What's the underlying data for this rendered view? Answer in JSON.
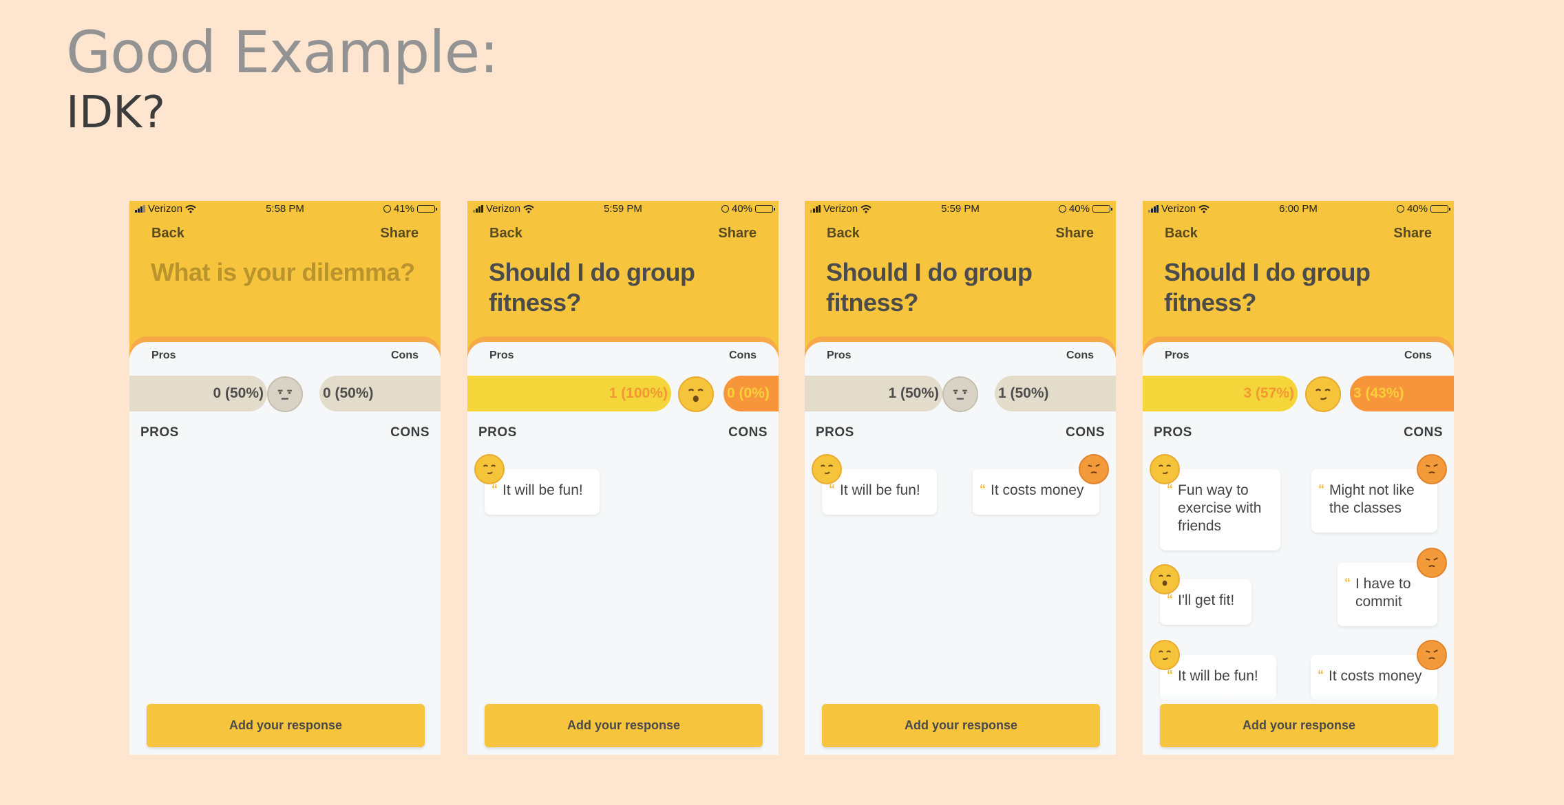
{
  "slide": {
    "title": "Good Example:",
    "subtitle": "IDK?"
  },
  "colors": {
    "accent_yellow": "#f6c53d",
    "accent_orange": "#f7953a",
    "background": "#fde5cf"
  },
  "phones": [
    {
      "status": {
        "carrier": "Verizon",
        "time": "5:58 PM",
        "battery": "41%"
      },
      "nav": {
        "back": "Back",
        "share": "Share"
      },
      "question": "What is your dilemma?",
      "labels": {
        "pros": "Pros",
        "cons": "Cons"
      },
      "tally": {
        "pros": "0 (50%)",
        "cons": "0 (50%)",
        "pros_fraction": 0.5
      },
      "columns": {
        "pros": "PROS",
        "cons": "CONS"
      },
      "pros_cards": [],
      "cons_cards": [],
      "button": "Add your response"
    },
    {
      "status": {
        "carrier": "Verizon",
        "time": "5:59 PM",
        "battery": "40%"
      },
      "nav": {
        "back": "Back",
        "share": "Share"
      },
      "question": "Should I do group fitness?",
      "labels": {
        "pros": "Pros",
        "cons": "Cons"
      },
      "tally": {
        "pros": "1 (100%)",
        "cons": "0 (0%)",
        "pros_fraction": 1.0
      },
      "columns": {
        "pros": "PROS",
        "cons": "CONS"
      },
      "pros_cards": [
        "It will be fun!"
      ],
      "cons_cards": [],
      "button": "Add your response"
    },
    {
      "status": {
        "carrier": "Verizon",
        "time": "5:59 PM",
        "battery": "40%"
      },
      "nav": {
        "back": "Back",
        "share": "Share"
      },
      "question": "Should I do group fitness?",
      "labels": {
        "pros": "Pros",
        "cons": "Cons"
      },
      "tally": {
        "pros": "1 (50%)",
        "cons": "1 (50%)",
        "pros_fraction": 0.5
      },
      "columns": {
        "pros": "PROS",
        "cons": "CONS"
      },
      "pros_cards": [
        "It will be fun!"
      ],
      "cons_cards": [
        "It costs money"
      ],
      "button": "Add your response"
    },
    {
      "status": {
        "carrier": "Verizon",
        "time": "6:00 PM",
        "battery": "40%"
      },
      "nav": {
        "back": "Back",
        "share": "Share"
      },
      "question": "Should I do group fitness?",
      "labels": {
        "pros": "Pros",
        "cons": "Cons"
      },
      "tally": {
        "pros": "3 (57%)",
        "cons": "3 (43%)",
        "pros_fraction": 0.57
      },
      "columns": {
        "pros": "PROS",
        "cons": "CONS"
      },
      "pros_cards": [
        "Fun way to exercise with friends",
        "I'll get fit!",
        "It will be fun!"
      ],
      "cons_cards": [
        "Might not like the classes",
        "I have to commit",
        "It costs money"
      ],
      "button": "Add your response"
    }
  ]
}
